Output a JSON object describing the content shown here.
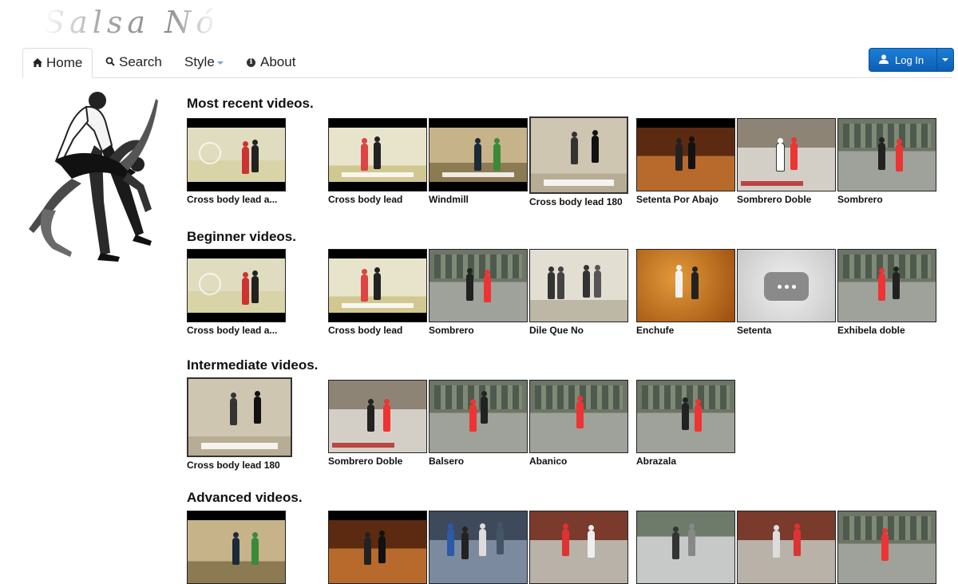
{
  "brand": {
    "logo_text": "Salsa Nó"
  },
  "nav": {
    "home": "Home",
    "search": "Search",
    "style": "Style",
    "about": "About"
  },
  "login": {
    "label": "Log In"
  },
  "sections": [
    {
      "title": "Most recent videos.",
      "videos": [
        "Cross body lead a...",
        "Cross body lead",
        "Windmill",
        "Cross body lead 180",
        "Setenta Por Abajo",
        "Sombrero Doble",
        "Sombrero"
      ]
    },
    {
      "title": "Beginner videos.",
      "videos": [
        "Cross body lead a...",
        "Cross body lead",
        "Sombrero",
        "Dile Que No",
        "Enchufe",
        "Setenta",
        "Exhibela doble"
      ]
    },
    {
      "title": "Intermediate videos.",
      "videos": [
        "Cross body lead 180",
        "Sombrero Doble",
        "Balsero",
        "Abanico",
        "Abrazala"
      ]
    },
    {
      "title": "Advanced videos.",
      "videos": [
        "",
        "",
        "",
        "",
        "",
        "",
        ""
      ]
    }
  ],
  "colors": {
    "accent": "#0c5fb4",
    "tab_border": "#dddddd"
  },
  "icons": {
    "home": "home-icon",
    "search": "search-icon",
    "about": "info-icon",
    "login": "user-icon"
  }
}
